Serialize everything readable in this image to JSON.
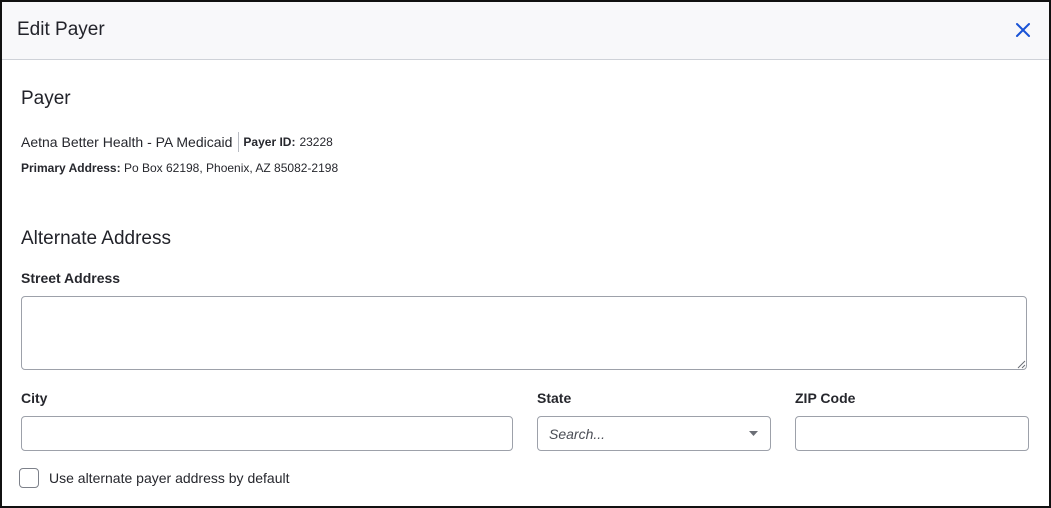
{
  "modal": {
    "title": "Edit Payer",
    "close_label": "Close"
  },
  "payer_section": {
    "title": "Payer",
    "name": "Aetna Better Health - PA Medicaid",
    "payer_id_label": "Payer ID:",
    "payer_id": "23228",
    "primary_address_label": "Primary Address:",
    "primary_address": "Po Box 62198, Phoenix, AZ 85082-2198"
  },
  "alternate_section": {
    "title": "Alternate Address",
    "street_label": "Street Address",
    "street_value": "",
    "city_label": "City",
    "city_value": "",
    "state_label": "State",
    "state_placeholder": "Search...",
    "zip_label": "ZIP Code",
    "zip_value": "",
    "default_checkbox_label": "Use alternate payer address by default",
    "default_checked": false
  },
  "colors": {
    "accent": "#1a53d6",
    "header_bg": "#f8f8fa",
    "border": "#9da1aa"
  }
}
